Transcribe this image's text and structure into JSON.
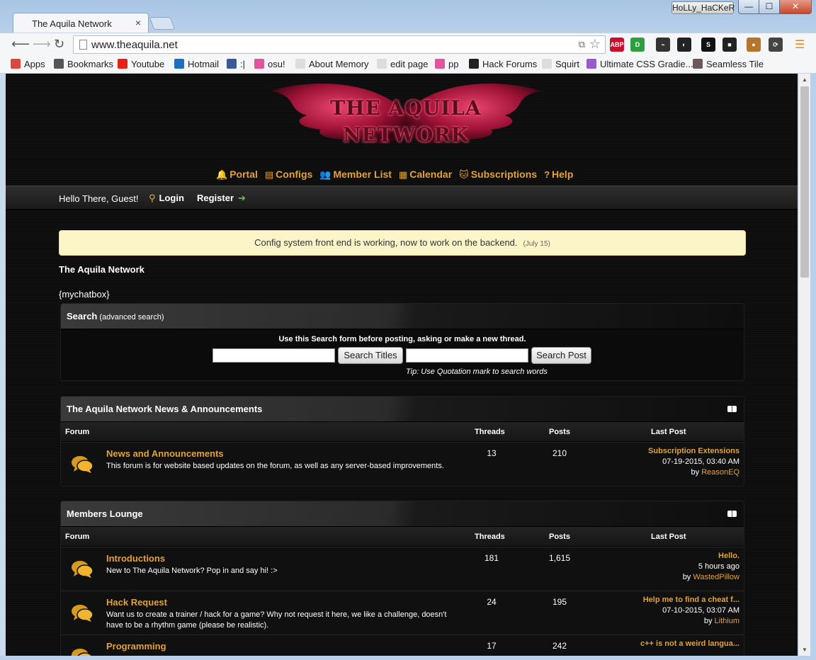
{
  "browser": {
    "tab_title": "The Aquila Network",
    "tab_close": "×",
    "user_badge": "HoLLy_HaCKeR",
    "window_min": "—",
    "window_max": "☐",
    "window_close": "✕",
    "url": "www.theaquila.net",
    "extensions": [
      {
        "label": "ABP",
        "color": "#c8102e"
      },
      {
        "label": "D",
        "color": "#2e9e3e"
      },
      {
        "label": "⌁",
        "color": "#333333"
      },
      {
        "label": "◐",
        "color": "#222222"
      },
      {
        "label": "S",
        "color": "#111111"
      },
      {
        "label": "■",
        "color": "#222222"
      },
      {
        "label": "●",
        "color": "#b5762c"
      },
      {
        "label": "⟳",
        "color": "#444444"
      }
    ],
    "bookmarks": [
      {
        "label": "Apps",
        "icon": "apps-grid-icon",
        "color": "#d84a3a"
      },
      {
        "label": "Bookmarks",
        "icon": "star-icon",
        "color": "#555555"
      },
      {
        "label": "Youtube",
        "icon": "youtube-icon",
        "color": "#e62117"
      },
      {
        "label": "Hotmail",
        "icon": "outlook-icon",
        "color": "#1d6ec0"
      },
      {
        "label": ":|",
        "icon": "facebook-icon",
        "color": "#3b5998"
      },
      {
        "label": "osu!",
        "icon": "osu-icon",
        "color": "#e0559b"
      },
      {
        "label": "About Memory",
        "icon": "page-icon",
        "color": "#dddddd"
      },
      {
        "label": "edit page",
        "icon": "page-icon",
        "color": "#dddddd"
      },
      {
        "label": "pp",
        "icon": "osu-icon",
        "color": "#e0559b"
      },
      {
        "label": "Hack Forums",
        "icon": "hackforums-icon",
        "color": "#222222"
      },
      {
        "label": "Squirt",
        "icon": "page-icon",
        "color": "#dddddd"
      },
      {
        "label": "Ultimate CSS Gradie...",
        "icon": "gradient-icon",
        "color": "#9b59d0"
      },
      {
        "label": "Seamless Tile",
        "icon": "tile-icon",
        "color": "#6a5a5a"
      }
    ]
  },
  "site": {
    "logo_line1": "THE AQUILA",
    "logo_line2": "NETWORK",
    "nav": [
      {
        "label": "Portal",
        "icon": "🔔"
      },
      {
        "label": "Configs",
        "icon": "▤"
      },
      {
        "label": "Member List",
        "icon": "👥"
      },
      {
        "label": "Calendar",
        "icon": "▦"
      },
      {
        "label": "Subscriptions",
        "icon": "🐱"
      },
      {
        "label": "Help",
        "icon": "?"
      }
    ],
    "greeting": "Hello There, Guest!",
    "login": "Login",
    "register": "Register",
    "announcement": "Config system front end is working, now to work on the backend.",
    "announcement_date": "(July 15)",
    "site_title": "The Aquila Network",
    "chatbox": "{mychatbox}"
  },
  "search": {
    "title": "Search",
    "subtitle": "(advanced search)",
    "hint": "Use this Search form before posting, asking or make a new thread.",
    "btn_titles": "Search Titles",
    "btn_posts": "Search Post",
    "tip": "Tip: Use Quotation mark to search words"
  },
  "columns": {
    "forum": "Forum",
    "threads": "Threads",
    "posts": "Posts",
    "last_post": "Last Post"
  },
  "categories": [
    {
      "title": "The Aquila Network News & Announcements",
      "forums": [
        {
          "name": "News and Announcements",
          "desc": "This forum is for website based updates on the forum, as well as any server-based improvements.",
          "threads": "13",
          "posts": "210",
          "last_title": "Subscription Extensions",
          "last_date": "07-19-2015, 03:40 AM",
          "last_by": "by",
          "last_user": "ReasonEQ"
        }
      ]
    },
    {
      "title": "Members Lounge",
      "forums": [
        {
          "name": "Introductions",
          "desc": "New to The Aquila Network? Pop in and say hi! :>",
          "threads": "181",
          "posts": "1,615",
          "last_title": "Hello.",
          "last_date": "5 hours ago",
          "last_by": "by",
          "last_user": "WastedPillow"
        },
        {
          "name": "Hack Request",
          "desc": "Want us to create a trainer / hack for a game? Why not request it here, we like a challenge, doesn't have to be a rhythm game (please be realistic).",
          "threads": "24",
          "posts": "195",
          "last_title": "Help me to find a cheat f...",
          "last_date": "07-10-2015, 03:07 AM",
          "last_by": "by",
          "last_user": "Lithium"
        },
        {
          "name": "Programming",
          "desc": "",
          "threads": "17",
          "posts": "242",
          "last_title": "c++ is not a weird langua...",
          "last_date": "",
          "last_by": "",
          "last_user": ""
        }
      ]
    }
  ]
}
